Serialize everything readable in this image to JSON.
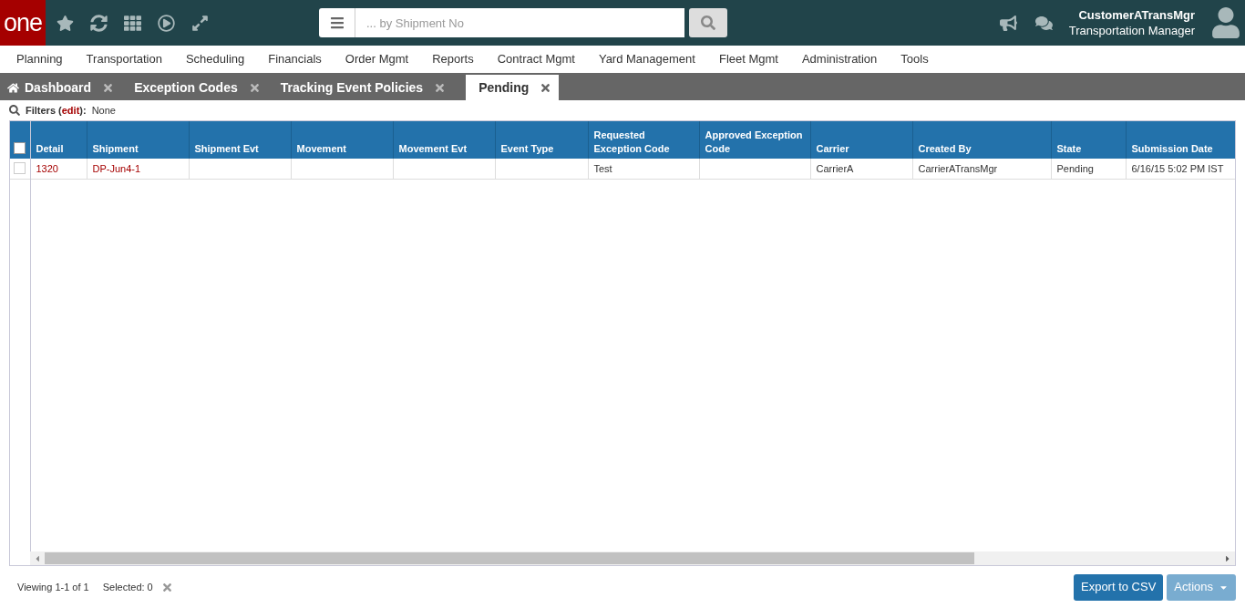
{
  "header": {
    "logo": "one",
    "search": {
      "placeholder": "... by Shipment No"
    },
    "user": {
      "name": "CustomerATransMgr",
      "role": "Transportation Manager"
    }
  },
  "menu": [
    "Planning",
    "Transportation",
    "Scheduling",
    "Financials",
    "Order Mgmt",
    "Reports",
    "Contract Mgmt",
    "Yard Management",
    "Fleet Mgmt",
    "Administration",
    "Tools"
  ],
  "tabs": [
    {
      "label": "Dashboard",
      "kind": "home",
      "selected": false
    },
    {
      "label": "Exception Codes",
      "kind": "plain",
      "selected": false
    },
    {
      "label": "Tracking Event Policies",
      "kind": "plain",
      "selected": false
    },
    {
      "label": "Pending",
      "kind": "plain",
      "selected": true
    }
  ],
  "filters": {
    "prefix": "Filters (",
    "link": "edit",
    "suffix": "):",
    "value": "None"
  },
  "table": {
    "all_checked": false,
    "columns": [
      "Detail",
      "Shipment",
      "Shipment Evt",
      "Movement",
      "Movement Evt",
      "Event Type",
      "Requested Exception Code",
      "Approved Exception Code",
      "Carrier",
      "Created By",
      "State",
      "Submission Date"
    ],
    "rows": [
      {
        "checked": false,
        "cells": [
          {
            "text": "1320",
            "kind": "link"
          },
          {
            "text": "DP-Jun4-1",
            "kind": "link"
          },
          null,
          null,
          null,
          null,
          {
            "text": "Test",
            "kind": "text"
          },
          null,
          {
            "text": "CarrierA",
            "kind": "text"
          },
          {
            "text": "CarrierATransMgr",
            "kind": "text"
          },
          {
            "text": "Pending",
            "kind": "text"
          },
          {
            "text": "6/16/15 5:02 PM IST",
            "kind": "text"
          }
        ]
      }
    ]
  },
  "footer": {
    "viewing": "Viewing 1-1 of 1",
    "selected": "Selected: 0",
    "buttons": [
      {
        "label": "Export to CSV",
        "kind": "primary"
      },
      {
        "label": "Actions",
        "kind": "menu"
      }
    ]
  }
}
